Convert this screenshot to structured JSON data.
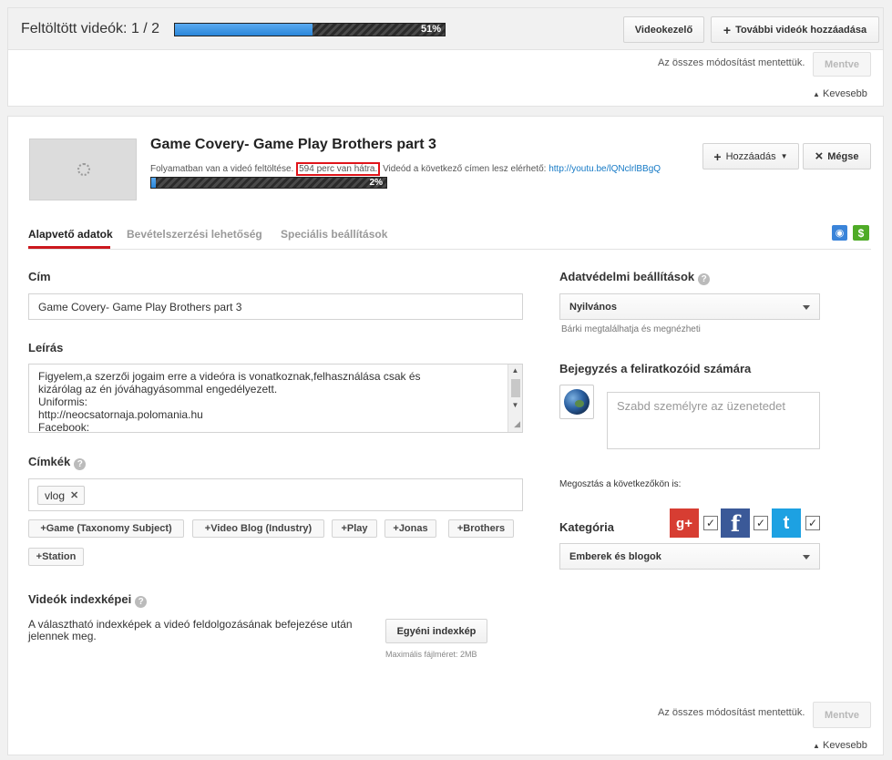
{
  "topbar": {
    "label": "Feltöltött videók: 1 / 2",
    "progress_percent": 51,
    "progress_label": "51%",
    "video_manager_button": "Videokezelő",
    "add_more_button": "További videók hozzáadása"
  },
  "first_panel": {
    "saved_note": "Az összes módosítást mentettük.",
    "save_button": "Mentve",
    "less_link": "Kevesebb"
  },
  "video": {
    "title": "Game Covery- Game Play Brothers part 3",
    "status_prefix": "Folyamatban van a videó feltöltése.",
    "time_left": "594 perc van hátra.",
    "available_at": "Videód a következő címen lesz elérhető:",
    "url": "http://youtu.be/lQNclrlBBgQ",
    "progress_percent": 2,
    "progress_label": "2%",
    "add_button": "Hozzáadás",
    "cancel_button": "Mégse"
  },
  "tabs": [
    {
      "label": "Alapvető adatok"
    },
    {
      "label": "Bevételszerzési lehetőség"
    },
    {
      "label": "Speciális beállítások"
    }
  ],
  "form": {
    "title_label": "Cím",
    "title_value": "Game Covery- Game Play Brothers part 3",
    "description_label": "Leírás",
    "description_lines": [
      "Figyelem,a szerzői jogaim erre a videóra is vonatkoznak,felhasználása csak és",
      "kizárólag az én jóváhagyásommal engedélyezett.",
      "Uniformis:",
      "http://neocsatornaja.polomania.hu",
      "Facebook:"
    ],
    "tags_label": "Címkék",
    "tags": [
      "vlog"
    ],
    "suggestions": [
      "+Game (Taxonomy Subject)",
      "+Video Blog (Industry)",
      "+Play",
      "+Jonas",
      "+Brothers",
      "+Station"
    ],
    "thumbnails_label": "Videók indexképei",
    "thumbnails_text": "A választható indexképek a videó feldolgozásának befejezése után jelennek meg.",
    "custom_thumb_button": "Egyéni indexkép",
    "max_size": "Maximális fájlméret: 2MB"
  },
  "sidebar": {
    "privacy_label": "Adatvédelmi beállítások",
    "privacy_value": "Nyilvános",
    "privacy_hint": "Bárki megtalálhatja és megnézheti",
    "post_label": "Bejegyzés a feliratkozóid számára",
    "post_placeholder": "Szabd személyre az üzenetedet",
    "share_label": "Megosztás a következőkön is:",
    "social": [
      {
        "name": "google-plus-icon",
        "glyph": "g+",
        "color": "#d73d32",
        "checked": true
      },
      {
        "name": "facebook-icon",
        "glyph": "f",
        "color": "#3b5998",
        "checked": true
      },
      {
        "name": "twitter-icon",
        "glyph": "t",
        "color": "#1da1e2",
        "checked": true
      }
    ],
    "category_label": "Kategória",
    "category_value": "Emberek és blogok"
  },
  "footer": {
    "saved_note": "Az összes módosítást mentettük.",
    "save_button": "Mentve",
    "less_link": "Kevesebb"
  },
  "glyphs": {
    "plus": "+",
    "close": "×",
    "caret_down": "▼",
    "triangle_up": "▲",
    "help": "?",
    "check": "✓",
    "globe": "◉",
    "dollar": "$",
    "tag_remove": "✕",
    "scroll_up": "▲",
    "scroll_down": "▼",
    "grip": "◢"
  },
  "colors": {
    "accent_red": "#cc181e",
    "link_blue": "#167ac6",
    "progress_blue": "#2b86d9"
  }
}
